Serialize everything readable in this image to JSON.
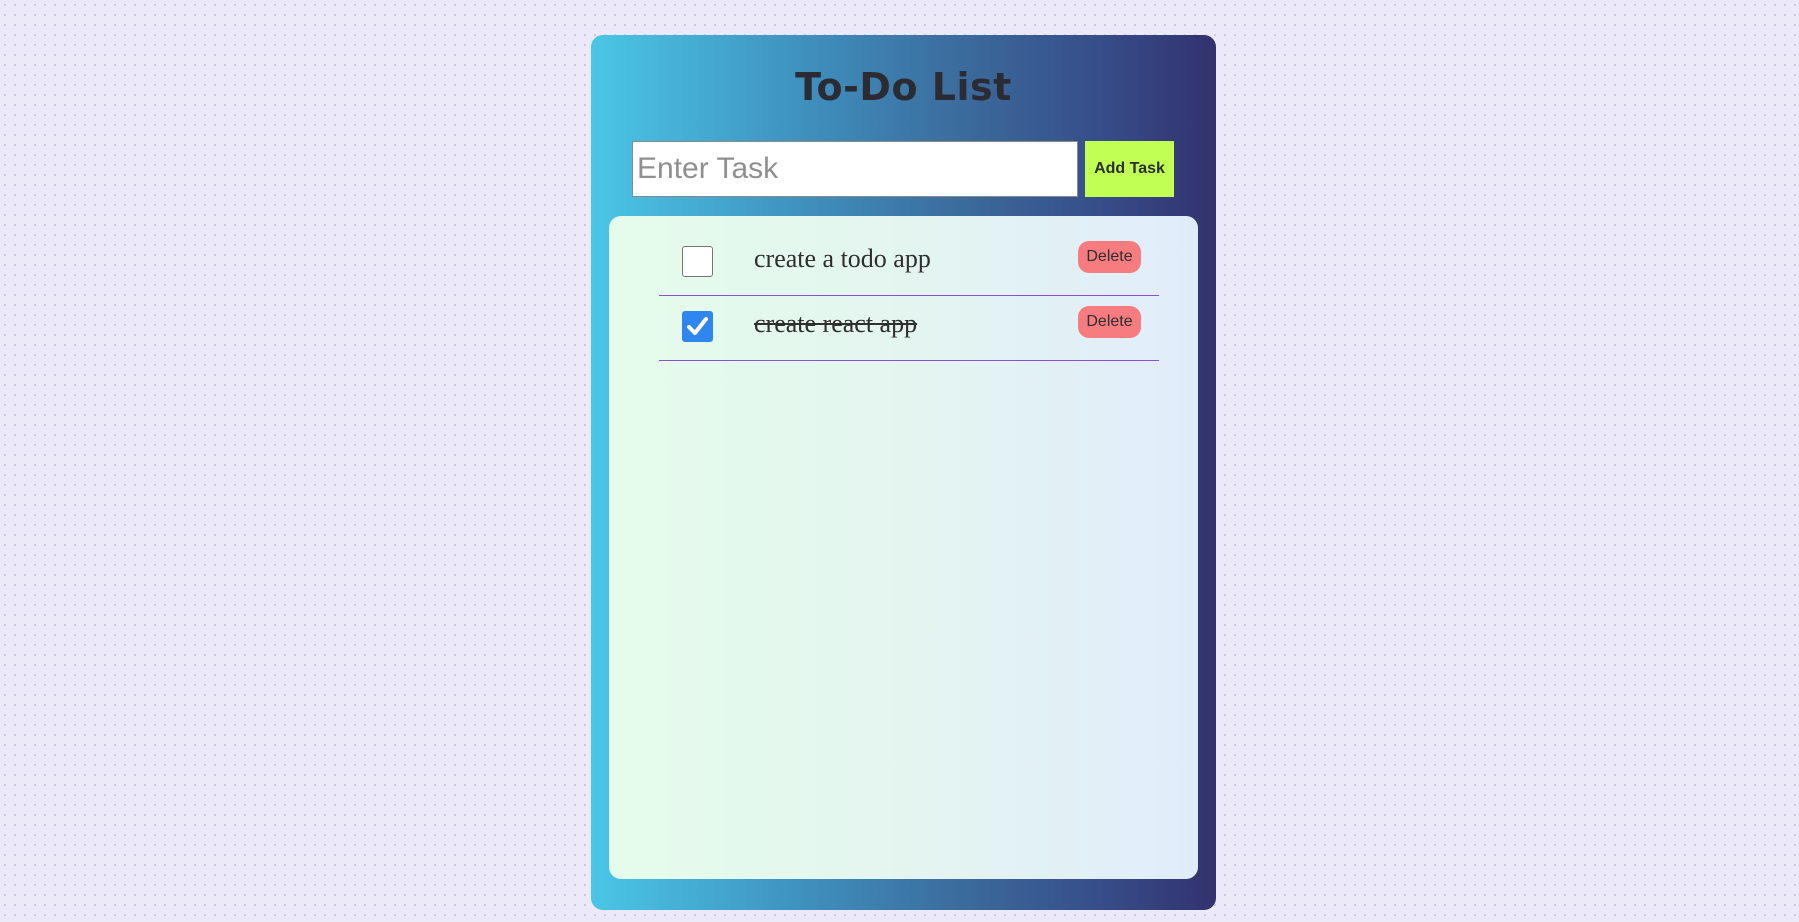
{
  "app": {
    "title": "To-Do List"
  },
  "input": {
    "placeholder": "Enter Task",
    "value": ""
  },
  "add_button": {
    "label": "Add Task"
  },
  "tasks": [
    {
      "text": "create a todo app",
      "completed": false,
      "delete_label": "Delete"
    },
    {
      "text": "create react app",
      "completed": true,
      "delete_label": "Delete"
    }
  ],
  "colors": {
    "page_background": "#ece9f9",
    "card_gradient_start": "#4ac6e6",
    "card_gradient_end": "#33326e",
    "add_button": "#c2ff55",
    "delete_button": "#f67c80",
    "checkbox_checked": "#2f86ee",
    "row_divider": "#8e4fd4"
  }
}
